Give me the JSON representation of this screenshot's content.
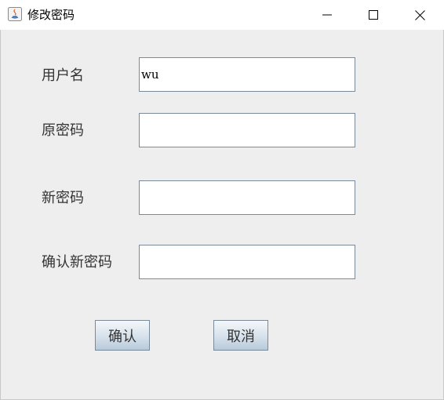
{
  "window": {
    "title": "修改密码",
    "icon": "java-icon",
    "controls": [
      "minimize-icon",
      "maximize-icon",
      "close-icon"
    ]
  },
  "form": {
    "username": {
      "label": "用户名",
      "value": "wu"
    },
    "old_password": {
      "label": "原密码",
      "value": ""
    },
    "new_password": {
      "label": "新密码",
      "value": ""
    },
    "confirm_password": {
      "label": "确认新密码",
      "value": ""
    }
  },
  "buttons": {
    "confirm": "确认",
    "cancel": "取消"
  },
  "colors": {
    "background": "#eeeeee",
    "field_border": "#7a8a99",
    "button_gradient_top": "#f4f7fa",
    "button_gradient_bottom": "#b8cadb"
  }
}
